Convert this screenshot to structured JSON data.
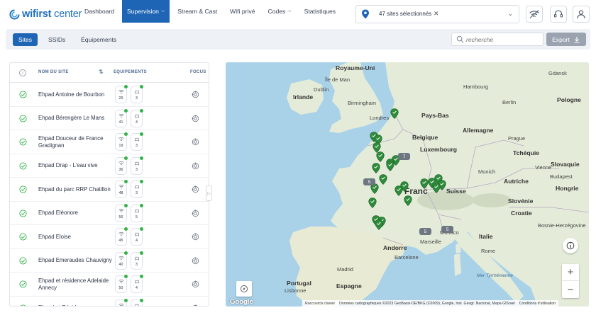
{
  "brand": {
    "name_bold": "wifirst",
    "name_light": "center"
  },
  "nav": {
    "items": [
      {
        "label": "Dashboard"
      },
      {
        "label": "Supervision"
      },
      {
        "label": "Stream & Cast"
      },
      {
        "label": "Wifi privé"
      },
      {
        "label": "Codes"
      },
      {
        "label": "Statistiques"
      }
    ]
  },
  "site_selector": {
    "value": "47 sites sélectionnés"
  },
  "subtabs": [
    {
      "label": "Sites"
    },
    {
      "label": "SSIDs"
    },
    {
      "label": "Équipements"
    }
  ],
  "search": {
    "placeholder": "recherche"
  },
  "export": {
    "label": "Export"
  },
  "table": {
    "headers": {
      "name": "NOM DU SITE",
      "equipements": "EQUIPEMENTS",
      "focus": "FOCUS"
    },
    "rows": [
      {
        "name": "Ehpad Antoine de Bourbon",
        "wifi": "29",
        "box": "3"
      },
      {
        "name": "Ehpad Bérengère Le Mans",
        "wifi": "41",
        "box": "4"
      },
      {
        "name": "Ehpad Douceur de France Gradignan",
        "wifi": "19",
        "box": "3"
      },
      {
        "name": "Ehpad Drap - L'eau vive",
        "wifi": "36",
        "box": "3"
      },
      {
        "name": "Ehpad du parc RRP Chatillon",
        "wifi": "48",
        "box": "3"
      },
      {
        "name": "Ehpad Eléonore",
        "wifi": "56",
        "box": "5"
      },
      {
        "name": "Ehpad Eloise",
        "wifi": "45",
        "box": "4"
      },
      {
        "name": "Ehpad Emeraudes Chauvigny",
        "wifi": "40",
        "box": "3"
      },
      {
        "name": "Ehpad et résidence Adelaide Annecy",
        "wifi": "50",
        "box": "4"
      },
      {
        "name": "Ehpad et Résidence",
        "wifi": "",
        "box": ""
      }
    ]
  },
  "map": {
    "labels": {
      "royaume_uni": "Royaume-Uni",
      "ile_de_man": "Île de Man",
      "irlande": "Irlande",
      "dublin": "Dublin",
      "birmingham": "Birmingham",
      "londres": "Londres",
      "pays_bas": "Pays-Bas",
      "belgique": "Belgique",
      "luxembourg": "Luxembourg",
      "allemagne": "Allemagne",
      "hambourg": "Hambourg",
      "berlin": "Berlin",
      "pologne": "Pologne",
      "gdansk": "Gdansk",
      "prague": "Prague",
      "tcheque": "Tchéquie",
      "slovaquie": "Slovaquie",
      "munich": "Munich",
      "vienne": "Vienne",
      "autriche": "Autriche",
      "budapest": "Budapest",
      "hongrie": "Hongrie",
      "suisse": "Suisse",
      "slovenie": "Slovénie",
      "croatie": "Croatie",
      "france": "Franc",
      "monaco": "Monaco",
      "marseille": "Marseille",
      "andorre": "Andorre",
      "barcelone": "Barcelone",
      "madrid": "Madrid",
      "espagne": "Espagne",
      "portugal": "Portugal",
      "lisbonne": "Lisbonne",
      "rome": "Rome",
      "italie": "Italie",
      "mer_tyrrhenienne": "Mer Tyrrhénienne",
      "bosnie": "Bosnie-Herzégovine",
      "google": "Google"
    },
    "clusters": [
      "7",
      "5",
      "5",
      "5"
    ],
    "attribution": {
      "shortcuts": "Raccourcis clavier",
      "data": "Données cartographiques ©2023 GeoBasis-DE/BKG (©2009), Google, Inst. Geogr. Nacional, Mapa GISrael",
      "terms": "Conditions d'utilisation"
    }
  },
  "colors": {
    "primary": "#1f65b5",
    "status_ok": "#34b34a",
    "marker": "#2e8b3a"
  }
}
